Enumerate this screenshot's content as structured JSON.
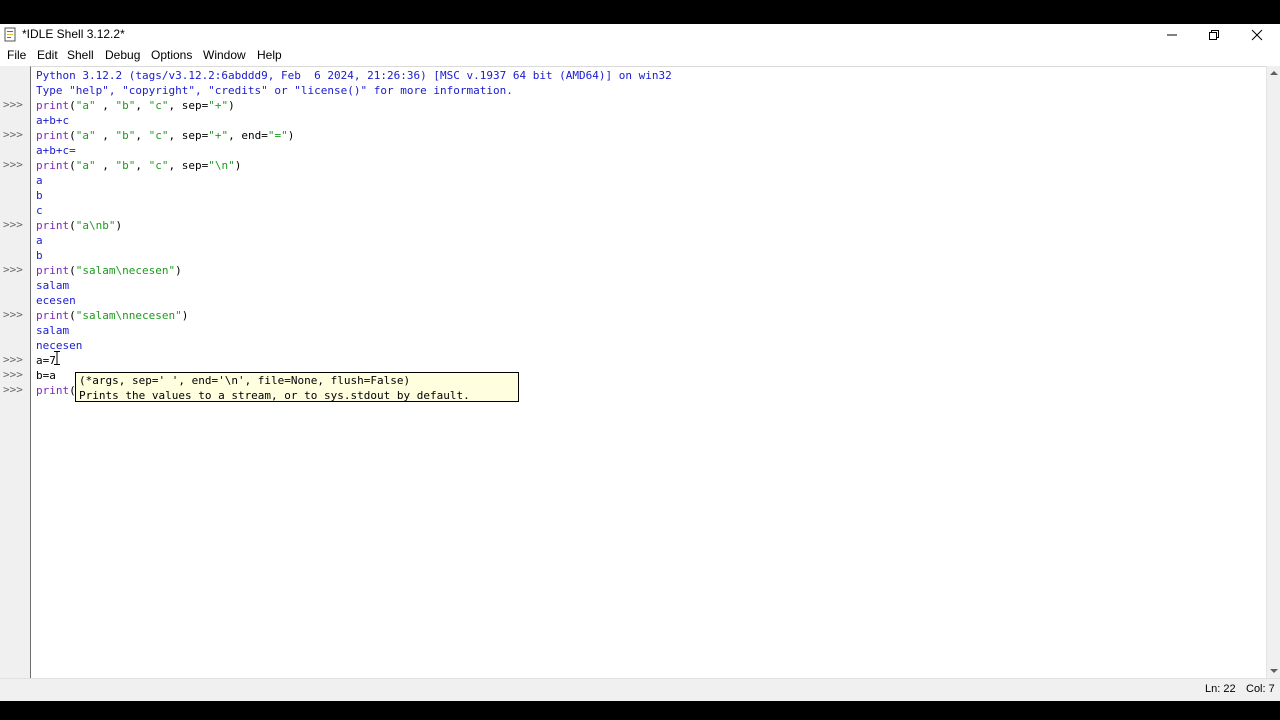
{
  "window": {
    "title": "*IDLE Shell 3.12.2*"
  },
  "menu": [
    "File",
    "Edit",
    "Shell",
    "Debug",
    "Options",
    "Window",
    "Help"
  ],
  "shell": {
    "prompt": ">>>",
    "lines": [
      {
        "prompt": false,
        "kind": "out",
        "text": "Python 3.12.2 (tags/v3.12.2:6abddd9, Feb  6 2024, 21:26:36) [MSC v.1937 64 bit (AMD64)] on win32"
      },
      {
        "prompt": false,
        "kind": "out",
        "text": "Type \"help\", \"copyright\", \"credits\" or \"license()\" for more information."
      },
      {
        "prompt": true,
        "kind": "code",
        "text": "print(\"a\" , \"b\", \"c\", sep=\"+\")"
      },
      {
        "prompt": false,
        "kind": "out",
        "text": "a+b+c"
      },
      {
        "prompt": true,
        "kind": "code",
        "text": "print(\"a\" , \"b\", \"c\", sep=\"+\", end=\"=\")"
      },
      {
        "prompt": false,
        "kind": "out",
        "text": "a+b+c="
      },
      {
        "prompt": true,
        "kind": "code",
        "text": "print(\"a\" , \"b\", \"c\", sep=\"\\n\")"
      },
      {
        "prompt": false,
        "kind": "out",
        "text": "a"
      },
      {
        "prompt": false,
        "kind": "out",
        "text": "b"
      },
      {
        "prompt": false,
        "kind": "out",
        "text": "c"
      },
      {
        "prompt": true,
        "kind": "code",
        "text": "print(\"a\\nb\")"
      },
      {
        "prompt": false,
        "kind": "out",
        "text": "a"
      },
      {
        "prompt": false,
        "kind": "out",
        "text": "b"
      },
      {
        "prompt": true,
        "kind": "code",
        "text": "print(\"salam\\necesen\")"
      },
      {
        "prompt": false,
        "kind": "out",
        "text": "salam"
      },
      {
        "prompt": false,
        "kind": "out",
        "text": "ecesen"
      },
      {
        "prompt": true,
        "kind": "code",
        "text": "print(\"salam\\nnecesen\")"
      },
      {
        "prompt": false,
        "kind": "out",
        "text": "salam"
      },
      {
        "prompt": false,
        "kind": "out",
        "text": "necesen"
      },
      {
        "prompt": true,
        "kind": "code",
        "text": "a=7"
      },
      {
        "prompt": true,
        "kind": "code",
        "text": "b=a"
      },
      {
        "prompt": true,
        "kind": "code",
        "text": "print(a"
      }
    ]
  },
  "tooltip": {
    "signature": "(*args, sep=' ', end='\\n', file=None, flush=False)",
    "doc": "Prints the values to a stream, or to sys.stdout by default."
  },
  "status": {
    "line": "Ln: 22",
    "col": "Col: 7"
  },
  "colors": {
    "output": "#1b1bd0",
    "keyword": "#7b29b6",
    "string": "#1f9a1f",
    "prompt": "#6a6a6a"
  }
}
